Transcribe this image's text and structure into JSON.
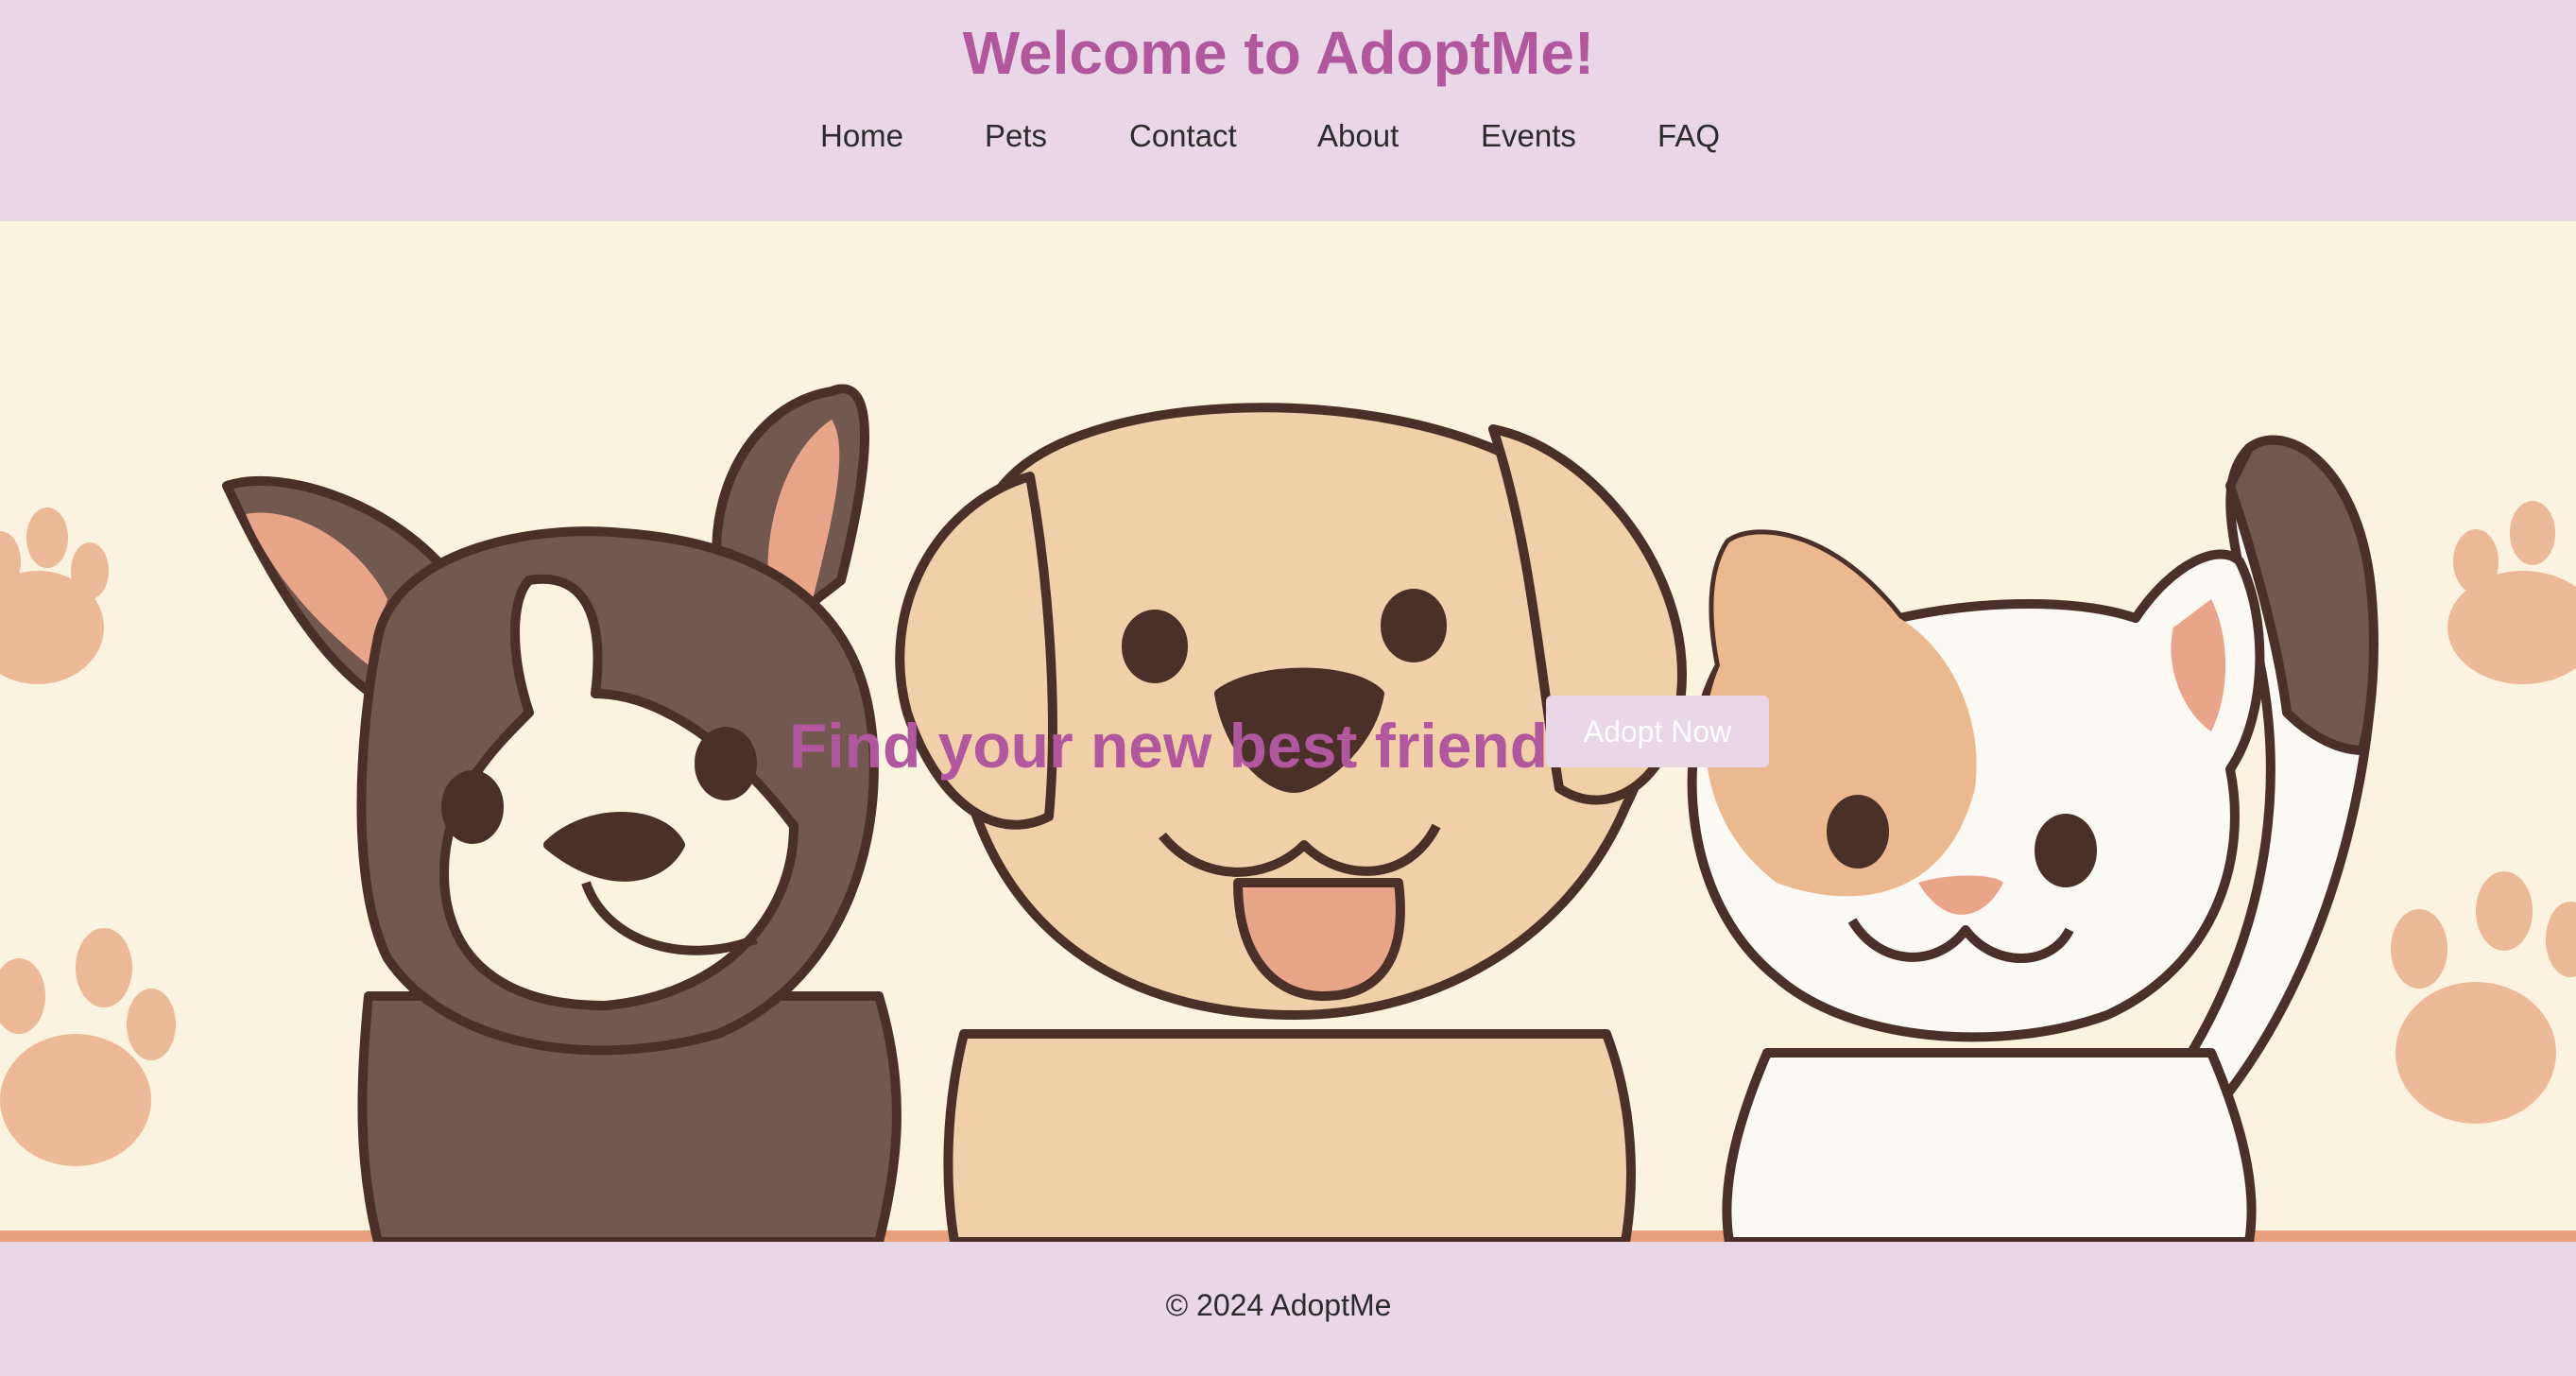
{
  "header": {
    "title": "Welcome to AdoptMe!",
    "nav": [
      "Home",
      "Pets",
      "Contact",
      "About",
      "Events",
      "FAQ"
    ]
  },
  "hero": {
    "headline": "Find your new best friend!",
    "cta_label": "Adopt Now",
    "illustration": "cartoon-dog-puppy-and-cat"
  },
  "footer": {
    "copyright": "© 2024 AdoptMe"
  },
  "colors": {
    "page_bg": "#e9d6e7",
    "accent": "#b0579e",
    "hero_bg": "#fcf2e0",
    "paw": "#eab291",
    "text": "#2b2b2b"
  }
}
